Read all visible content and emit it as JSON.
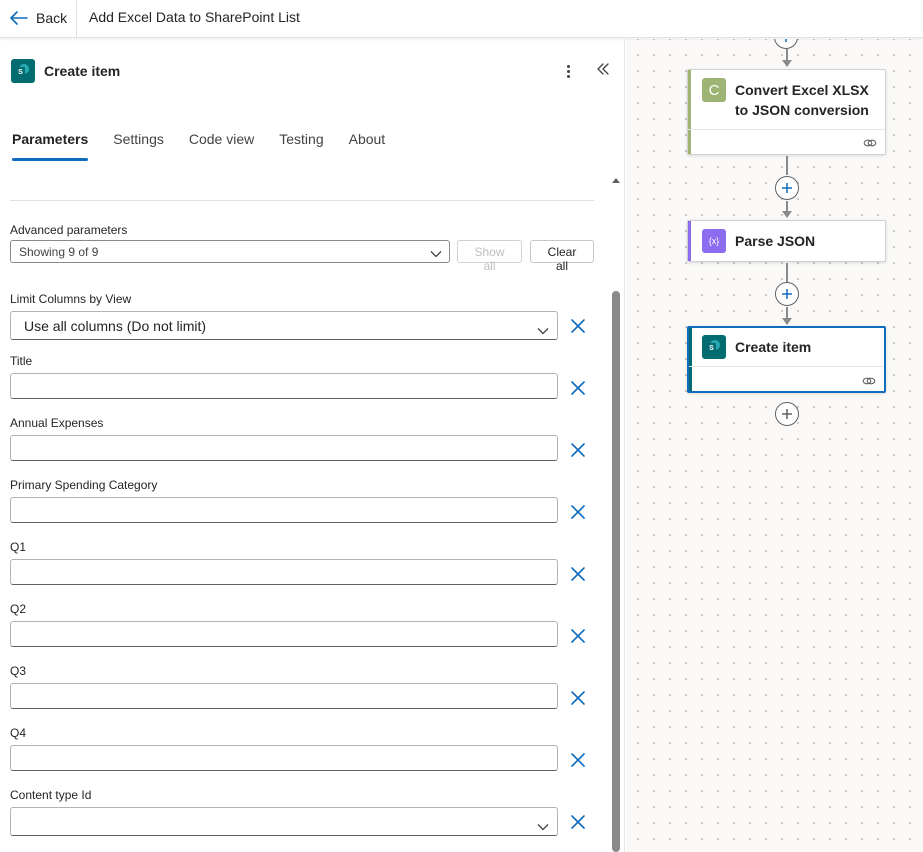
{
  "topbar": {
    "back_label": "Back",
    "flow_title": "Add Excel Data to SharePoint List"
  },
  "panel": {
    "title": "Create item",
    "tabs": [
      {
        "label": "Parameters",
        "active": true
      },
      {
        "label": "Settings",
        "active": false
      },
      {
        "label": "Code view",
        "active": false
      },
      {
        "label": "Testing",
        "active": false
      },
      {
        "label": "About",
        "active": false
      }
    ],
    "advanced": {
      "label": "Advanced parameters",
      "selected": "Showing 9 of 9",
      "show_all": "Show all",
      "clear_all": "Clear all"
    },
    "fields": [
      {
        "label": "Limit Columns by View",
        "value": "Use all columns (Do not limit)",
        "type": "select"
      },
      {
        "label": "Title",
        "value": "",
        "type": "text"
      },
      {
        "label": "Annual Expenses",
        "value": "",
        "type": "text"
      },
      {
        "label": "Primary Spending Category",
        "value": "",
        "type": "text"
      },
      {
        "label": "Q1",
        "value": "",
        "type": "text"
      },
      {
        "label": "Q2",
        "value": "",
        "type": "text"
      },
      {
        "label": "Q3",
        "value": "",
        "type": "text"
      },
      {
        "label": "Q4",
        "value": "",
        "type": "text"
      },
      {
        "label": "Content type Id",
        "value": "",
        "type": "select"
      }
    ]
  },
  "canvas": {
    "cards": [
      {
        "title": "Convert Excel XLSX to JSON conversion",
        "icon": "C",
        "accent": "#9eb475",
        "icon_color": "#9eb475"
      },
      {
        "title": "Parse JSON",
        "icon": "{x}",
        "accent": "#8c6cf0",
        "icon_color": "#8c6cf0"
      },
      {
        "title": "Create item",
        "icon": "S",
        "accent": "#036c70",
        "icon_color": "#036c70",
        "selected": true
      }
    ]
  },
  "colors": {
    "accent_blue": "#0f6cbd",
    "sharepoint_teal": "#036c70"
  }
}
